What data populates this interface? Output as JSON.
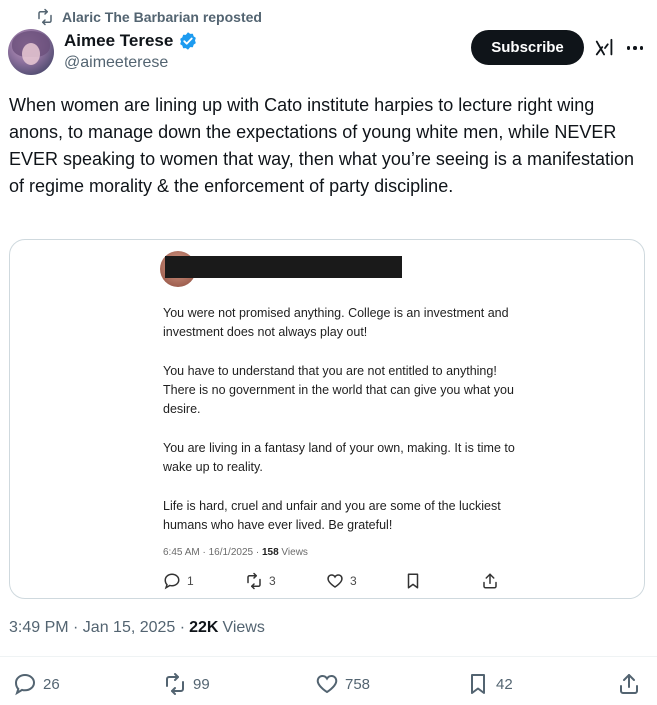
{
  "repost": {
    "icon": "repost-icon",
    "text": "Alaric The Barbarian reposted"
  },
  "author": {
    "name": "Aimee Terese",
    "handle": "@aimeeterese",
    "verified_icon": "verified-badge-icon"
  },
  "header_actions": {
    "subscribe_label": "Subscribe",
    "grok_icon": "grok-icon",
    "more_icon": "more-icon"
  },
  "tweet": {
    "text": "When women are lining up with Cato institute harpies to lecture right wing anons, to manage down the expectations of young white men, while NEVER EVER  speaking to women that way, then what you’re seeing is a manifestation of regime morality & the enforcement of party discipline."
  },
  "embedded": {
    "paragraphs": [
      "You were not promised anything. College is an investment and investment does not always play out!",
      "You have to understand that you are not entitled to anything! There is no government in the world that can give you what you desire.",
      "You are living in a fantasy land of your own, making. It is time to wake up to reality.",
      "Life is hard, cruel and unfair and you are some of the luckiest humans who have ever lived. Be grateful!"
    ],
    "meta_time": "6:45 AM · 16/1/2025 · ",
    "meta_views_count": "158",
    "meta_views_label": " Views",
    "replies": "1",
    "reposts": "3",
    "likes": "3"
  },
  "timestamp": {
    "time": "3:49 PM · Jan 15, 2025 ·",
    "views_count": "22K",
    "views_label": "Views"
  },
  "actions": {
    "replies": "26",
    "reposts": "99",
    "likes": "758",
    "bookmarks": "42"
  },
  "colors": {
    "text": "#0f1419",
    "muted": "#536471",
    "accent": "#1d9bf0",
    "button": "#0f1419",
    "border": "#cfd9de"
  }
}
